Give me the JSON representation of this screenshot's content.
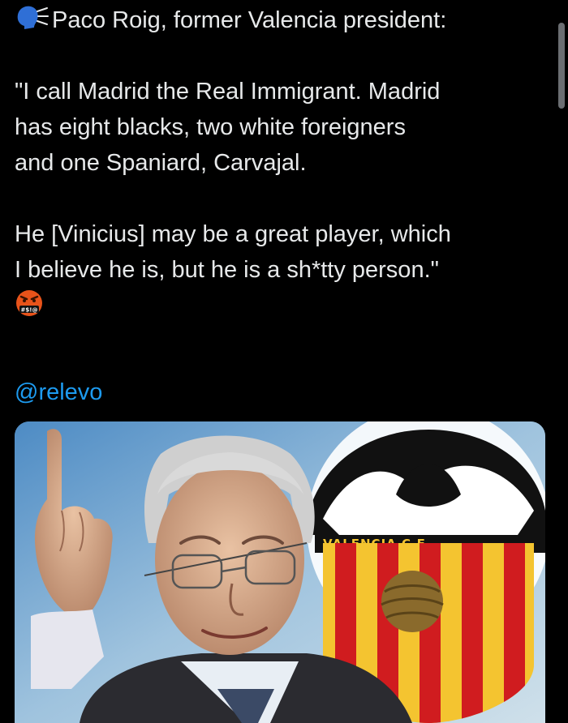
{
  "tweet": {
    "lines": [
      "Paco Roig, former Valencia president:",
      "\"I call Madrid the Real Immigrant. Madrid",
      "has eight blacks, two white foreigners",
      "and one Spaniard, Carvajal.",
      "He [Vinicius] may be a great player, which",
      "I believe he is, but he is a sh*tty person.\""
    ],
    "leading_icon": "speaking-head-icon",
    "trailing_emoji": "angry-face-with-symbols-icon",
    "emoji_label": "#$!@",
    "handle": "@relevo"
  },
  "media": {
    "crest_text": "VALENCIA C.F.",
    "colors": {
      "crest_gold": "#f4c430",
      "crest_red": "#d01c1f",
      "sky": "#7fb0d4"
    }
  },
  "colors": {
    "background": "#000000",
    "text": "#e7e9ea",
    "link": "#1d9bf0"
  }
}
